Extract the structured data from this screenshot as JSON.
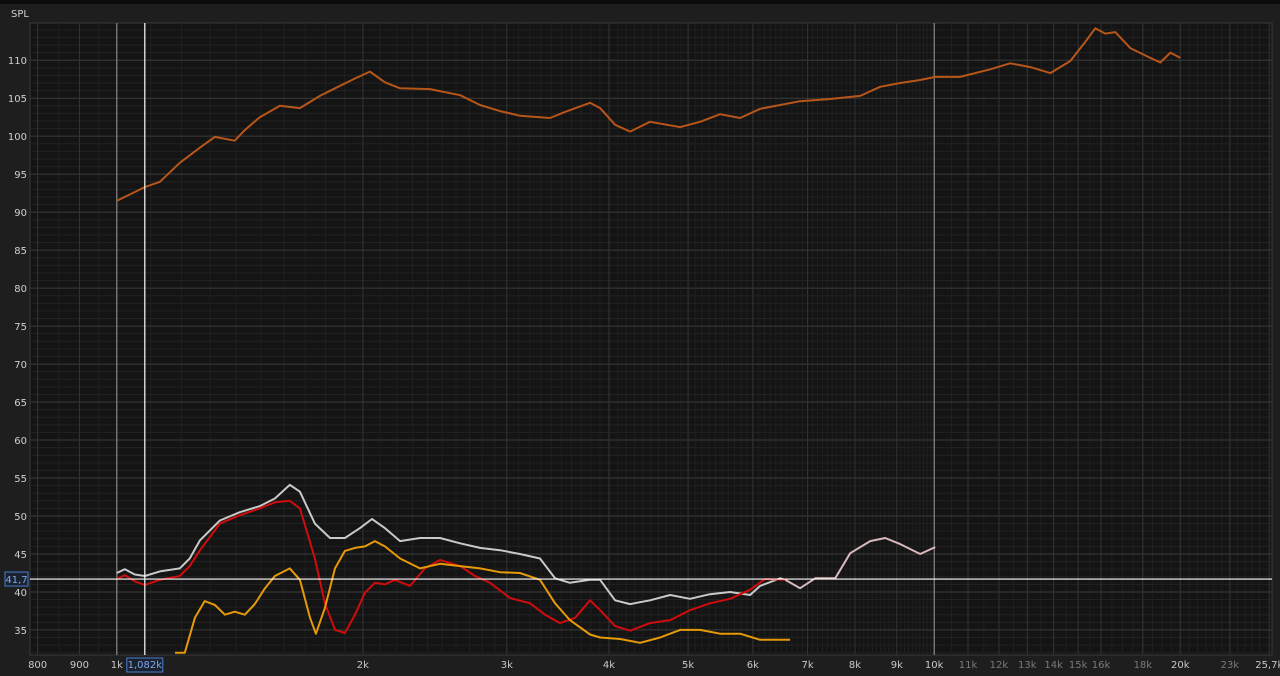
{
  "chart_data": {
    "type": "line",
    "ylabel": "SPL",
    "xscale": "log",
    "xlim": [
      783,
      25900
    ],
    "ylim": [
      31.7,
      114.9
    ],
    "grid": true,
    "y_ticks": [
      35,
      40,
      45,
      50,
      55,
      60,
      65,
      70,
      75,
      80,
      85,
      90,
      95,
      100,
      105,
      110
    ],
    "x_ticks": [
      {
        "f": 800,
        "label": "800",
        "dim": false
      },
      {
        "f": 900,
        "label": "900",
        "dim": false
      },
      {
        "f": 1000,
        "label": "1k",
        "dim": false
      },
      {
        "f": 2000,
        "label": "2k",
        "dim": false
      },
      {
        "f": 3000,
        "label": "3k",
        "dim": false
      },
      {
        "f": 4000,
        "label": "4k",
        "dim": false
      },
      {
        "f": 5000,
        "label": "5k",
        "dim": false
      },
      {
        "f": 6000,
        "label": "6k",
        "dim": false
      },
      {
        "f": 7000,
        "label": "7k",
        "dim": false
      },
      {
        "f": 8000,
        "label": "8k",
        "dim": false
      },
      {
        "f": 9000,
        "label": "9k",
        "dim": false
      },
      {
        "f": 10000,
        "label": "10k",
        "dim": false
      },
      {
        "f": 11000,
        "label": "11k",
        "dim": true
      },
      {
        "f": 12000,
        "label": "12k",
        "dim": true
      },
      {
        "f": 13000,
        "label": "13k",
        "dim": true
      },
      {
        "f": 14000,
        "label": "14k",
        "dim": true
      },
      {
        "f": 15000,
        "label": "15k",
        "dim": true
      },
      {
        "f": 16000,
        "label": "16k",
        "dim": true
      },
      {
        "f": 18000,
        "label": "18k",
        "dim": true
      },
      {
        "f": 20000,
        "label": "20k",
        "dim": false
      },
      {
        "f": 23000,
        "label": "23k",
        "dim": true
      },
      {
        "f": 25700,
        "label": "25,7k",
        "dim": false
      }
    ],
    "cursor": {
      "x_value": 1082,
      "x_label": "1,082k",
      "y_value": 41.7,
      "y_label": "41,7"
    },
    "markers": [
      1000,
      10000
    ],
    "series": [
      {
        "name": "spl-brown",
        "color": "#b8561a",
        "points": [
          [
            1000,
            91.5
          ],
          [
            1082,
            93.3
          ],
          [
            1129,
            94.0
          ],
          [
            1194,
            96.5
          ],
          [
            1264,
            98.5
          ],
          [
            1318,
            99.9
          ],
          [
            1394,
            99.4
          ],
          [
            1434,
            100.8
          ],
          [
            1496,
            102.5
          ],
          [
            1583,
            104.0
          ],
          [
            1675,
            103.7
          ],
          [
            1772,
            105.3
          ],
          [
            1849,
            106.3
          ],
          [
            1956,
            107.6
          ],
          [
            2040,
            108.5
          ],
          [
            2128,
            107.1
          ],
          [
            2221,
            106.3
          ],
          [
            2416,
            106.2
          ],
          [
            2630,
            105.4
          ],
          [
            2782,
            104.1
          ],
          [
            2943,
            103.3
          ],
          [
            3113,
            102.7
          ],
          [
            3388,
            102.4
          ],
          [
            3534,
            103.2
          ],
          [
            3793,
            104.4
          ],
          [
            3902,
            103.7
          ],
          [
            4070,
            101.5
          ],
          [
            4246,
            100.6
          ],
          [
            4491,
            101.9
          ],
          [
            4888,
            101.2
          ],
          [
            5171,
            101.9
          ],
          [
            5471,
            102.9
          ],
          [
            5788,
            102.4
          ],
          [
            6124,
            103.6
          ],
          [
            6855,
            104.6
          ],
          [
            7459,
            104.9
          ],
          [
            8118,
            105.3
          ],
          [
            8588,
            106.5
          ],
          [
            9088,
            107.0
          ],
          [
            9614,
            107.4
          ],
          [
            10028,
            107.8
          ],
          [
            10760,
            107.8
          ],
          [
            11712,
            108.8
          ],
          [
            12388,
            109.6
          ],
          [
            13109,
            109.1
          ],
          [
            13868,
            108.3
          ],
          [
            14673,
            109.9
          ],
          [
            15302,
            112.4
          ],
          [
            15743,
            114.2
          ],
          [
            16190,
            113.5
          ],
          [
            16657,
            113.7
          ],
          [
            17376,
            111.6
          ],
          [
            18383,
            110.3
          ],
          [
            18908,
            109.7
          ],
          [
            19451,
            111.0
          ],
          [
            20005,
            110.3
          ]
        ]
      },
      {
        "name": "grey",
        "color": "#c9c9c9",
        "points": [
          [
            1000,
            42.5
          ],
          [
            1023,
            43.0
          ],
          [
            1052,
            42.3
          ],
          [
            1082,
            42.1
          ],
          [
            1129,
            42.7
          ],
          [
            1194,
            43.1
          ],
          [
            1228,
            44.4
          ],
          [
            1264,
            46.8
          ],
          [
            1337,
            49.4
          ],
          [
            1414,
            50.5
          ],
          [
            1496,
            51.3
          ],
          [
            1561,
            52.3
          ],
          [
            1628,
            54.1
          ],
          [
            1675,
            53.2
          ],
          [
            1747,
            49.0
          ],
          [
            1823,
            47.1
          ],
          [
            1901,
            47.1
          ],
          [
            1984,
            48.4
          ],
          [
            2052,
            49.6
          ],
          [
            2128,
            48.4
          ],
          [
            2221,
            46.7
          ],
          [
            2349,
            47.1
          ],
          [
            2485,
            47.1
          ],
          [
            2630,
            46.4
          ],
          [
            2782,
            45.8
          ],
          [
            2943,
            45.5
          ],
          [
            3113,
            45.0
          ],
          [
            3294,
            44.4
          ],
          [
            3437,
            41.8
          ],
          [
            3584,
            41.2
          ],
          [
            3793,
            41.6
          ],
          [
            3902,
            41.6
          ],
          [
            4070,
            38.9
          ],
          [
            4246,
            38.4
          ],
          [
            4491,
            38.9
          ],
          [
            4753,
            39.6
          ],
          [
            5026,
            39.1
          ],
          [
            5318,
            39.7
          ],
          [
            5627,
            40.0
          ],
          [
            5953,
            39.6
          ],
          [
            6124,
            40.8
          ],
          [
            6480,
            41.8
          ],
          [
            6572,
            41.6
          ]
        ]
      },
      {
        "name": "pink",
        "color": "#d9b9bb",
        "points": [
          [
            6572,
            41.6
          ],
          [
            6855,
            40.5
          ],
          [
            7152,
            41.8
          ],
          [
            7566,
            41.8
          ],
          [
            7893,
            45.1
          ],
          [
            8350,
            46.7
          ],
          [
            8710,
            47.1
          ],
          [
            9088,
            46.3
          ],
          [
            9614,
            45.0
          ],
          [
            10028,
            45.9
          ]
        ]
      },
      {
        "name": "red",
        "color": "#d00c0c",
        "points": [
          [
            1000,
            41.7
          ],
          [
            1023,
            42.2
          ],
          [
            1052,
            41.4
          ],
          [
            1082,
            40.9
          ],
          [
            1129,
            41.6
          ],
          [
            1194,
            42.1
          ],
          [
            1228,
            43.4
          ],
          [
            1264,
            45.5
          ],
          [
            1337,
            49.0
          ],
          [
            1414,
            50.1
          ],
          [
            1496,
            51.0
          ],
          [
            1561,
            51.8
          ],
          [
            1628,
            52.0
          ],
          [
            1675,
            51.0
          ],
          [
            1747,
            44.4
          ],
          [
            1797,
            38.5
          ],
          [
            1849,
            35.0
          ],
          [
            1901,
            34.6
          ],
          [
            1956,
            37.0
          ],
          [
            2012,
            39.9
          ],
          [
            2069,
            41.2
          ],
          [
            2128,
            41.0
          ],
          [
            2189,
            41.6
          ],
          [
            2284,
            40.8
          ],
          [
            2382,
            43.1
          ],
          [
            2485,
            44.2
          ],
          [
            2630,
            43.4
          ],
          [
            2743,
            42.1
          ],
          [
            2861,
            41.2
          ],
          [
            3027,
            39.2
          ],
          [
            3203,
            38.5
          ],
          [
            3342,
            37.0
          ],
          [
            3485,
            35.9
          ],
          [
            3636,
            36.6
          ],
          [
            3793,
            38.9
          ],
          [
            3902,
            37.6
          ],
          [
            4070,
            35.5
          ],
          [
            4246,
            34.9
          ],
          [
            4491,
            35.9
          ],
          [
            4753,
            36.3
          ],
          [
            5026,
            37.6
          ],
          [
            5318,
            38.5
          ],
          [
            5627,
            39.1
          ],
          [
            5953,
            40.3
          ],
          [
            6211,
            41.7
          ],
          [
            6572,
            41.6
          ]
        ]
      },
      {
        "name": "orange",
        "color": "#e69a08",
        "points": [
          [
            1178,
            32.0
          ],
          [
            1211,
            32.0
          ],
          [
            1246,
            36.6
          ],
          [
            1281,
            38.8
          ],
          [
            1318,
            38.3
          ],
          [
            1356,
            37.0
          ],
          [
            1394,
            37.4
          ],
          [
            1434,
            37.0
          ],
          [
            1475,
            38.4
          ],
          [
            1518,
            40.5
          ],
          [
            1561,
            42.1
          ],
          [
            1628,
            43.1
          ],
          [
            1675,
            41.6
          ],
          [
            1723,
            36.6
          ],
          [
            1752,
            34.5
          ],
          [
            1797,
            37.9
          ],
          [
            1849,
            43.1
          ],
          [
            1901,
            45.4
          ],
          [
            1956,
            45.8
          ],
          [
            2012,
            46.0
          ],
          [
            2069,
            46.7
          ],
          [
            2128,
            46.0
          ],
          [
            2221,
            44.4
          ],
          [
            2349,
            43.1
          ],
          [
            2485,
            43.7
          ],
          [
            2630,
            43.4
          ],
          [
            2782,
            43.1
          ],
          [
            2943,
            42.6
          ],
          [
            3113,
            42.5
          ],
          [
            3294,
            41.6
          ],
          [
            3437,
            38.5
          ],
          [
            3584,
            36.3
          ],
          [
            3793,
            34.4
          ],
          [
            3902,
            34.0
          ],
          [
            4127,
            33.8
          ],
          [
            4367,
            33.3
          ],
          [
            4620,
            34.0
          ],
          [
            4888,
            35.0
          ],
          [
            5171,
            35.0
          ],
          [
            5471,
            34.5
          ],
          [
            5788,
            34.5
          ],
          [
            6124,
            33.7
          ],
          [
            6664,
            33.7
          ]
        ]
      }
    ]
  }
}
